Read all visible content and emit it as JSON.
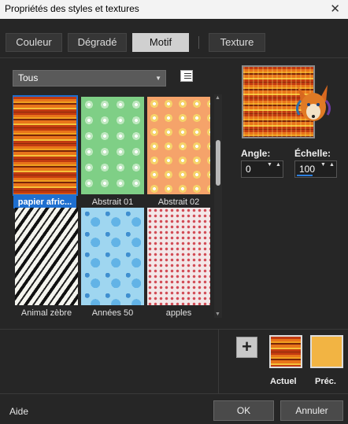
{
  "window": {
    "title": "Propriétés des styles et textures",
    "close_glyph": "✕"
  },
  "tabs": [
    {
      "label": "Couleur"
    },
    {
      "label": "Dégradé"
    },
    {
      "label": "Motif"
    },
    {
      "label": "Texture"
    }
  ],
  "active_tab": "Motif",
  "category": {
    "selected": "Tous"
  },
  "patterns": [
    {
      "label": "papier afric...",
      "selected": true
    },
    {
      "label": "Abstrait 01"
    },
    {
      "label": "Abstrait 02"
    },
    {
      "label": "Animal zèbre"
    },
    {
      "label": "Années 50"
    },
    {
      "label": "apples"
    }
  ],
  "angle": {
    "label": "Angle:",
    "value": "0"
  },
  "scale": {
    "label": "Échelle:",
    "value": "100"
  },
  "swatches": {
    "current_label": "Actuel",
    "previous_label": "Préc.",
    "previous_color": "#f2b443"
  },
  "footer": {
    "help": "Aide",
    "ok": "OK",
    "cancel": "Annuler"
  },
  "colors": {
    "accent": "#1e6fd0",
    "background": "#262626"
  }
}
